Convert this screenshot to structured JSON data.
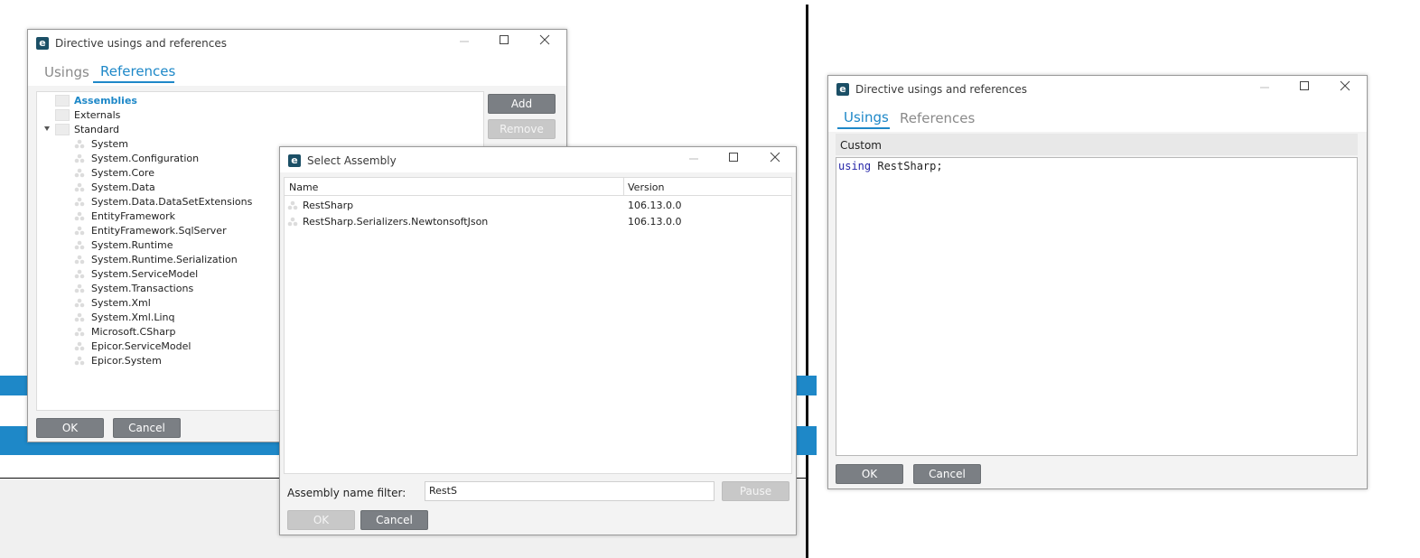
{
  "left_dialog": {
    "title": "Directive usings and references",
    "tabs": [
      "Usings",
      "References"
    ],
    "active_tab": "References",
    "tree": {
      "folders": [
        "Assemblies",
        "Externals",
        "Standard"
      ],
      "standard_children": [
        "System",
        "System.Configuration",
        "System.Core",
        "System.Data",
        "System.Data.DataSetExtensions",
        "EntityFramework",
        "EntityFramework.SqlServer",
        "System.Runtime",
        "System.Runtime.Serialization",
        "System.ServiceModel",
        "System.Transactions",
        "System.Xml",
        "System.Xml.Linq",
        "Microsoft.CSharp",
        "Epicor.ServiceModel",
        "Epicor.System"
      ]
    },
    "add_label": "Add",
    "remove_label": "Remove",
    "ok_label": "OK",
    "cancel_label": "Cancel"
  },
  "select_assembly": {
    "title": "Select Assembly",
    "columns": [
      "Name",
      "Version"
    ],
    "rows": [
      {
        "name": "RestSharp",
        "version": "106.13.0.0"
      },
      {
        "name": "RestSharp.Serializers.NewtonsoftJson",
        "version": "106.13.0.0"
      }
    ],
    "filter_label": "Assembly name filter:",
    "filter_value": "RestS",
    "pause_label": "Pause",
    "ok_label": "OK",
    "cancel_label": "Cancel"
  },
  "right_dialog": {
    "title": "Directive usings and references",
    "tabs": [
      "Usings",
      "References"
    ],
    "active_tab": "Usings",
    "section_label": "Custom",
    "code_keyword": "using",
    "code_rest": " RestSharp;",
    "ok_label": "OK",
    "cancel_label": "Cancel"
  },
  "colors": {
    "accent": "#1e88c8",
    "button": "#7b7f84",
    "keyword": "#2626a8"
  },
  "icons": [
    "app-logo-icon",
    "minimize-icon",
    "maximize-icon",
    "close-icon",
    "folder-icon",
    "assembly-icon",
    "expand-arrow-icon"
  ]
}
